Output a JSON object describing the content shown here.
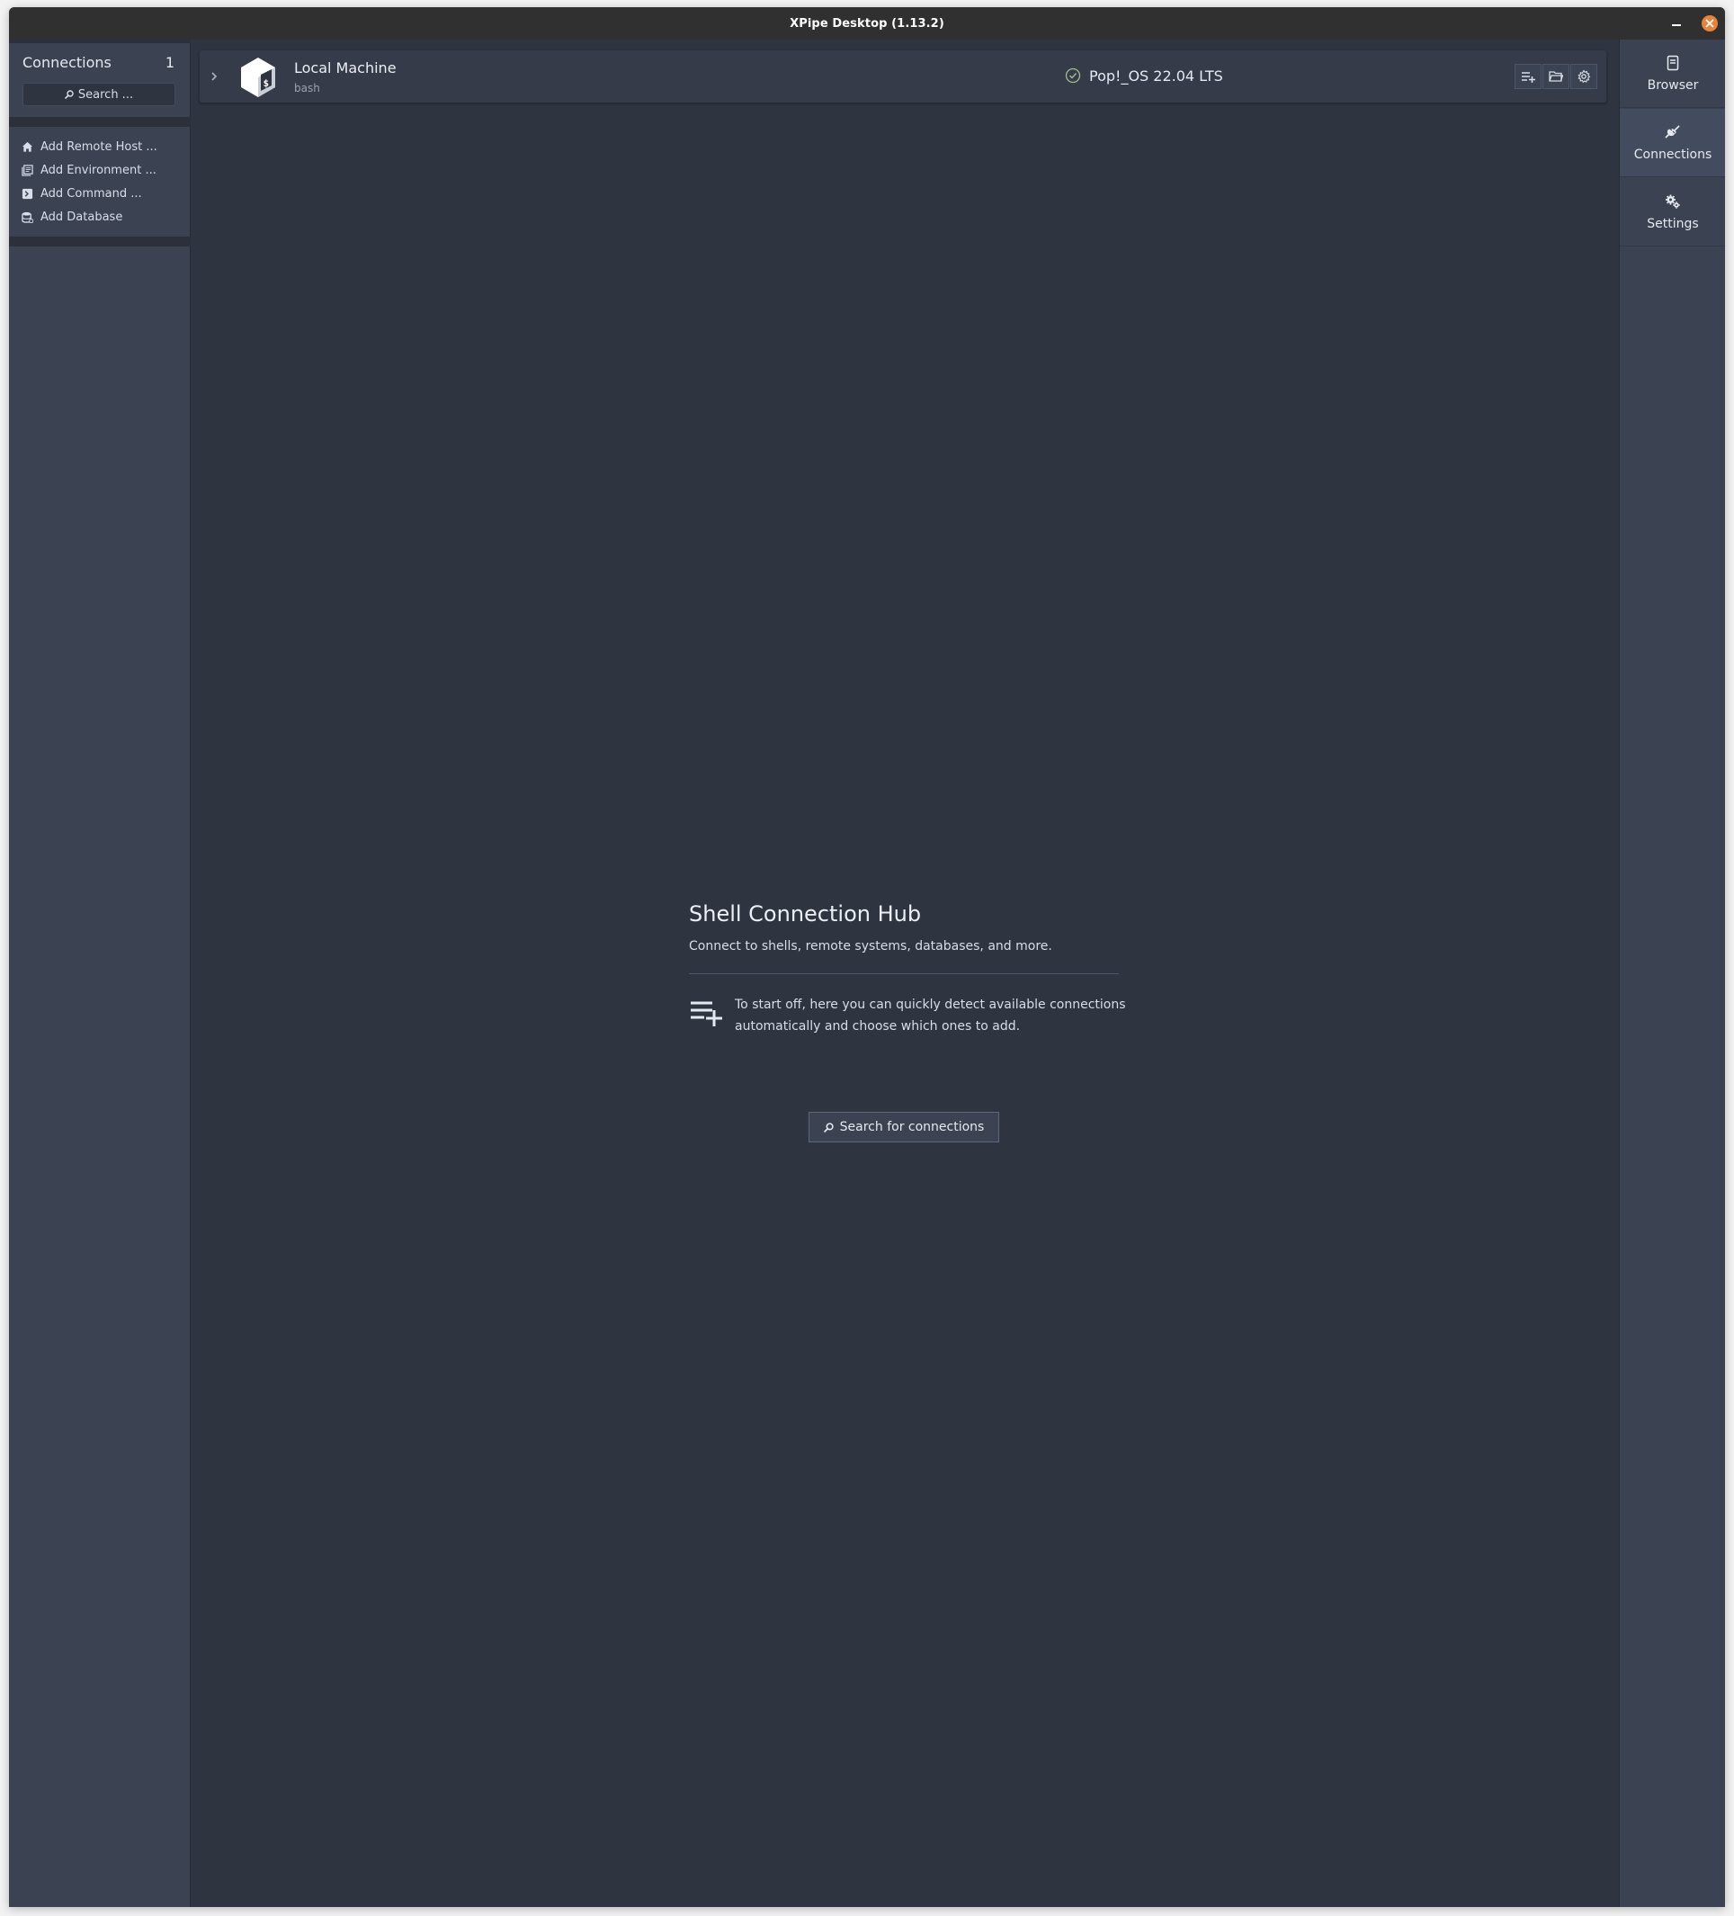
{
  "window": {
    "title": "XPipe Desktop (1.13.2)"
  },
  "sidebar": {
    "title": "Connections",
    "count": "1",
    "search_label": "Search ...",
    "actions": [
      {
        "label": "Add Remote Host ...",
        "icon": "house-icon"
      },
      {
        "label": "Add Environment ...",
        "icon": "environment-icon"
      },
      {
        "label": "Add Command ...",
        "icon": "terminal-icon"
      },
      {
        "label": "Add Database",
        "icon": "database-icon"
      }
    ]
  },
  "connection": {
    "name": "Local Machine",
    "shell": "bash",
    "os": "Pop!_OS 22.04 LTS",
    "buttons": [
      "add-list-icon",
      "folder-icon",
      "gear-icon"
    ]
  },
  "hub": {
    "title": "Shell Connection Hub",
    "subtitle": "Connect to shells, remote systems, databases, and more.",
    "tip": "To start off, here you can quickly detect available connections automatically and choose which ones to add.",
    "button_label": "Search for connections"
  },
  "rightnav": {
    "items": [
      {
        "label": "Browser",
        "icon": "browser-icon"
      },
      {
        "label": "Connections",
        "icon": "plug-icon"
      },
      {
        "label": "Settings",
        "icon": "gears-icon"
      }
    ]
  },
  "colors": {
    "accent_close": "#e8833a",
    "main_bg": "#2e3440",
    "panel_bg": "#3b4252"
  }
}
